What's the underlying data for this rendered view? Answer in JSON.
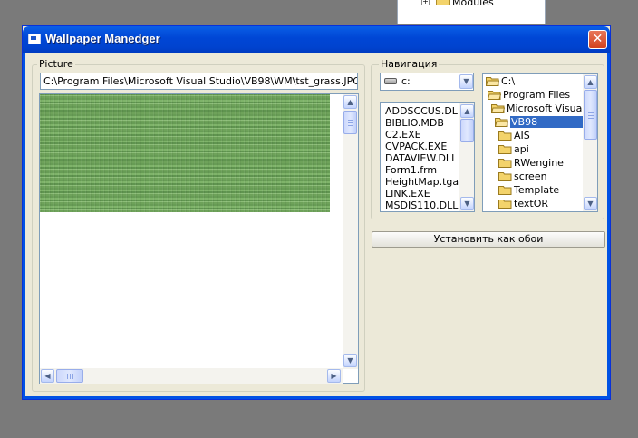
{
  "background_window": {
    "tree_label": "Modules",
    "expander": "+"
  },
  "window": {
    "title": "Wallpaper Manedger",
    "close_glyph": "✕"
  },
  "picture_group": {
    "label": "Picture",
    "path_value": "C:\\Program Files\\Microsoft Visual Studio\\VB98\\WM\\tst_grass.JPG"
  },
  "nav_group": {
    "label": "Навигация"
  },
  "drive": {
    "value": "c:"
  },
  "files": [
    "ADDSCCUS.DLL",
    "BIBLIO.MDB",
    "C2.EXE",
    "CVPACK.EXE",
    "DATAVIEW.DLL",
    "Form1.frm",
    "HeightMap.tga",
    "LINK.EXE",
    "MSDIS110.DLL"
  ],
  "dirs": [
    {
      "name": "C:\\",
      "level": 0,
      "open": true
    },
    {
      "name": "Program Files",
      "level": 1,
      "open": true
    },
    {
      "name": "Microsoft Visual Studio",
      "level": 2,
      "open": true
    },
    {
      "name": "VB98",
      "level": 3,
      "open": true,
      "selected": true
    },
    {
      "name": "AIS",
      "level": 4
    },
    {
      "name": "api",
      "level": 4
    },
    {
      "name": "RWengine",
      "level": 4
    },
    {
      "name": "screen",
      "level": 4
    },
    {
      "name": "Template",
      "level": 4
    },
    {
      "name": "textOR",
      "level": 4
    }
  ],
  "buttons": {
    "set_wallpaper": "Установить как обои"
  },
  "colors": {
    "selection": "#316ac5",
    "title_bar": "#0054e3",
    "dialog_bg": "#ece9d8",
    "folder": "#f3d36b"
  },
  "icons": {
    "drive": "hard-drive-icon",
    "folder_closed": "folder-icon",
    "folder_open": "open-folder-icon"
  }
}
